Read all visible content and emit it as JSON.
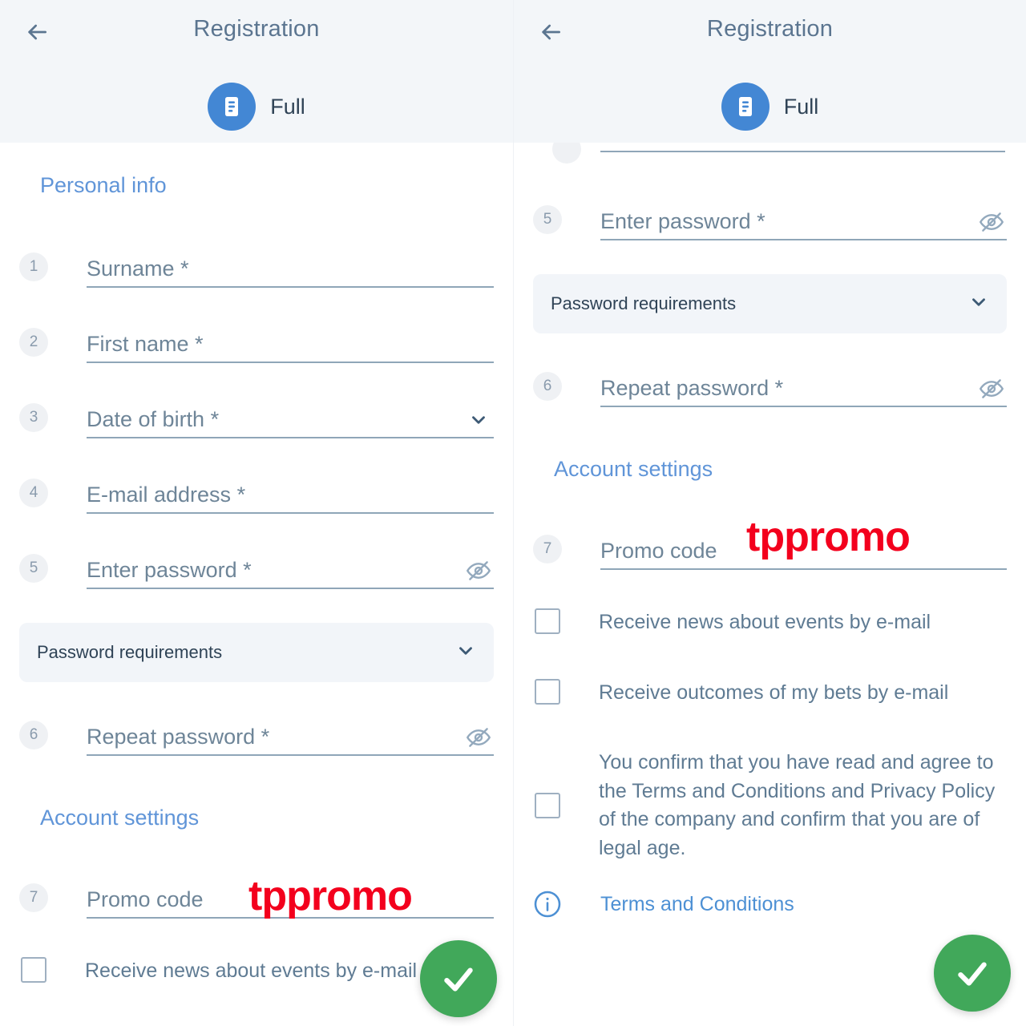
{
  "header": {
    "title": "Registration",
    "back_icon": "arrow-left-icon",
    "badge_icon": "document-form-icon",
    "badge_label": "Full"
  },
  "sections": {
    "personal_info": "Personal info",
    "account_settings": "Account settings"
  },
  "fields": {
    "surname": {
      "num": "1",
      "label": "Surname *"
    },
    "first_name": {
      "num": "2",
      "label": "First name *"
    },
    "date_of_birth": {
      "num": "3",
      "label": "Date of birth *",
      "action_icon": "chevron-down-icon"
    },
    "email": {
      "num": "4",
      "label": "E-mail address *"
    },
    "password": {
      "num": "5",
      "label": "Enter password *",
      "action_icon": "eye-off-icon"
    },
    "repeat_password": {
      "num": "6",
      "label": "Repeat password *",
      "action_icon": "eye-off-icon"
    },
    "promo_code": {
      "num": "7",
      "label": "Promo code",
      "value": "tppromo"
    }
  },
  "password_requirements": {
    "label": "Password requirements",
    "action_icon": "chevron-down-icon"
  },
  "checkboxes": {
    "news": "Receive news about events by e-mail",
    "bets": "Receive outcomes of my bets by e-mail",
    "terms": "You confirm that you have read and agree to the Terms and Conditions and Privacy Policy of the company and confirm that you are of legal age."
  },
  "terms_link": {
    "icon": "info-circle-icon",
    "label": "Terms and Conditions"
  },
  "submit": {
    "icon": "check-icon",
    "label": ""
  },
  "colors": {
    "accent_blue": "#4387d4",
    "section_blue": "#6095d8",
    "annotation_red": "#f3001d",
    "submit_green": "#41a85a",
    "header_bg": "#f3f6f9",
    "field_underline": "#8fa6b8"
  }
}
